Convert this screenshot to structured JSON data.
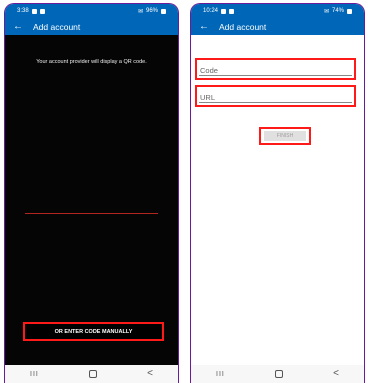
{
  "phone1": {
    "status": {
      "time": "3:38",
      "signal": "96%"
    },
    "appbar": {
      "title": "Add account"
    },
    "instruction": "Your account provider will display a QR code.",
    "manual_button": "OR ENTER CODE MANUALLY"
  },
  "phone2": {
    "status": {
      "time": "10:24",
      "signal": "74%"
    },
    "appbar": {
      "title": "Add account"
    },
    "code_placeholder": "Code",
    "url_placeholder": "URL",
    "finish_button": "FINISH"
  },
  "navbar": {
    "recent": "III",
    "back": "<"
  },
  "icons": {
    "back": "arrow-left",
    "home": "square-outline"
  },
  "colors": {
    "app_blue": "#0067b8",
    "highlight_red": "#ff1a1a"
  }
}
